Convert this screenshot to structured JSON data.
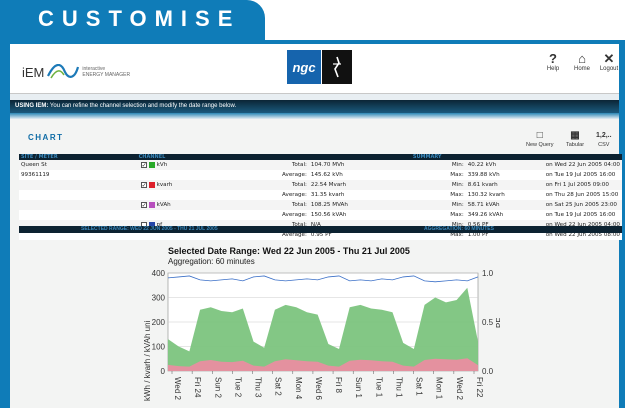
{
  "page": {
    "tab_title": "CUSTOMISE"
  },
  "header": {
    "logo_text": "iEM",
    "logo_sub_1": "interactive",
    "logo_sub_2": "ENERGY MANAGER",
    "partner_logo": "ngc",
    "nav": [
      {
        "label": "Help",
        "icon": "?"
      },
      {
        "label": "Home",
        "icon": "⌂"
      },
      {
        "label": "Logout",
        "icon": "✕"
      }
    ]
  },
  "using_bar": {
    "title": "USING IEM:",
    "text": "You can refine the channel selection and modify the date range below."
  },
  "chart_panel": {
    "title": "CHART",
    "actions": [
      {
        "label": "New Query",
        "icon": "□"
      },
      {
        "label": "Tabular",
        "icon": "▦"
      },
      {
        "label": "CSV",
        "icon": "1,2,.."
      }
    ]
  },
  "summary": {
    "headers": {
      "site": "SITE / METER",
      "channel": "CHANNEL",
      "summary": "SUMMARY"
    },
    "site_name": "Queen St",
    "meter_id": "99361119",
    "rows": [
      {
        "channel": "kVh",
        "color": "#27a827",
        "total_label": "Total:",
        "total": "104.70 MVh",
        "avg_label": "Average:",
        "avg": "145.62 kVh",
        "min_label": "Min:",
        "min": "40.22 kVh",
        "min_time": "on Wed 22 Jun 2005 04:00",
        "max_label": "Max:",
        "max": "339.88 kVh",
        "max_time": "on Tue 19 Jul 2005 16:00"
      },
      {
        "channel": "kvarh",
        "color": "#dd1f2a",
        "total_label": "Total:",
        "total": "22.54 Mvarh",
        "avg_label": "Average:",
        "avg": "31.35 kvarh",
        "min_label": "Min:",
        "min": "8.61 kvarh",
        "min_time": "on Fri 1 Jul 2005 09:00",
        "max_label": "Max:",
        "max": "130.32 kvarh",
        "max_time": "on Thu 28 Jun 2005 15:00"
      },
      {
        "channel": "kVAh",
        "color": "#b74fbd",
        "total_label": "Total:",
        "total": "108.25 MVAh",
        "avg_label": "Average:",
        "avg": "150.56 kVAh",
        "min_label": "Min:",
        "min": "58.71 kVAh",
        "min_time": "on Sat 25 Jun 2005 23:00",
        "max_label": "Max:",
        "max": "349.26 kVAh",
        "max_time": "on Tue 19 Jul 2005 16:00"
      },
      {
        "channel": "pf",
        "color": "#2446a8",
        "total_label": "Total:",
        "total": "N/A",
        "avg_label": "Average:",
        "avg": "0.95 PF",
        "min_label": "Min:",
        "min": "0.56 PF",
        "min_time": "on Wed 22 Jun 2005 04:00",
        "max_label": "Max:",
        "max": "1.00 PF",
        "max_time": "on Wed 22 Jun 2005 08:00"
      }
    ],
    "selected_range": "SELECTED RANGE: WED 22 JUN 2005 - THU 21 JUL 2005",
    "aggregation": "AGGREGATION: 60 MINUTES"
  },
  "chart_data": {
    "type": "area",
    "title": "Selected Date Range: Wed 22 Jun 2005 - Thu 21 Jul 2005",
    "subtitle": "Aggregation: 60 minutes",
    "ylabel": "kWh / kvarh / kVAh uni",
    "y2label": "PF",
    "ylim": [
      0,
      400
    ],
    "y2lim": [
      0.0,
      1.0
    ],
    "y_ticks": [
      "400",
      "300",
      "200",
      "100",
      "0"
    ],
    "y2_ticks": [
      "1.0",
      "0.5",
      "0.0"
    ],
    "x_ticks": [
      "Wed 2",
      "Fri 24",
      "Sun 2",
      "Tue 2",
      "Thu 3",
      "Sat 2",
      "Mon 4",
      "Wed 6",
      "Fri 8",
      "Sun 1",
      "Tue 1",
      "Thu 1",
      "Sat 1",
      "Mon 1",
      "Wed 2",
      "Fri 22"
    ],
    "series": [
      {
        "name": "kVh",
        "color": "#7cc47e",
        "values": [
          130,
          100,
          80,
          250,
          260,
          245,
          240,
          255,
          120,
          95,
          250,
          270,
          260,
          240,
          230,
          110,
          90,
          260,
          270,
          255,
          250,
          240,
          115,
          90,
          270,
          300,
          280,
          290,
          340,
          120
        ]
      },
      {
        "name": "kvarh",
        "color": "#e98ea0",
        "values": [
          25,
          20,
          18,
          40,
          45,
          38,
          36,
          42,
          22,
          18,
          40,
          48,
          44,
          40,
          38,
          22,
          18,
          42,
          46,
          44,
          40,
          38,
          22,
          18,
          45,
          50,
          48,
          46,
          52,
          24
        ]
      },
      {
        "name": "pf",
        "color": "#3a6fc7",
        "values": [
          0.95,
          0.96,
          0.97,
          0.93,
          0.92,
          0.93,
          0.94,
          0.92,
          0.96,
          0.97,
          0.93,
          0.92,
          0.93,
          0.94,
          0.93,
          0.96,
          0.97,
          0.92,
          0.93,
          0.92,
          0.94,
          0.93,
          0.96,
          0.97,
          0.92,
          0.91,
          0.92,
          0.93,
          0.92,
          0.96
        ]
      }
    ]
  }
}
